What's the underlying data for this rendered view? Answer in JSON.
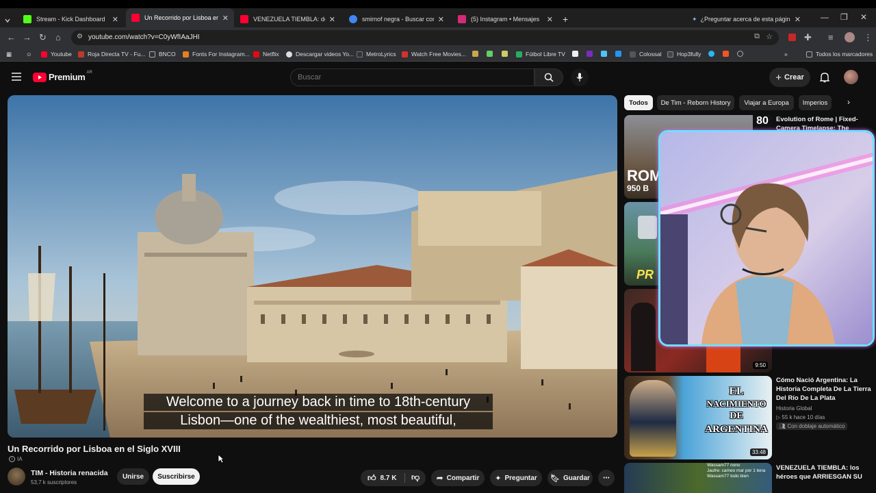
{
  "browser": {
    "tabs": [
      {
        "title": "Stream - Kick Dashboard",
        "color": "#53fc18",
        "active": false
      },
      {
        "title": "Un Recorrido por Lisboa en el S",
        "color": "#ff0033",
        "active": true
      },
      {
        "title": "VENEZUELA TIEMBLA: dentro d",
        "color": "#ff0033",
        "active": false
      },
      {
        "title": "smirnof negra - Buscar con Goo",
        "color": "#4285f4",
        "active": false
      },
      {
        "title": "(5) Instagram • Mensajes",
        "color": "#d62976",
        "active": false
      }
    ],
    "ask_page": "¿Preguntar acerca de esta página?",
    "url": "youtube.com/watch?v=C0yWfIAaJHI",
    "bookmarks": [
      {
        "label": "Youtube",
        "color": "#ff0033"
      },
      {
        "label": "Roja Directa TV - Fu...",
        "color": "#c0392b"
      },
      {
        "label": "BNCO",
        "color": "#888888"
      },
      {
        "label": "Fonts For Instagram...",
        "color": "#e67e22"
      },
      {
        "label": "Netflix",
        "color": "#e50914"
      },
      {
        "label": "Descargar videos Yo...",
        "color": "#dddddd"
      },
      {
        "label": "MetroLyrics",
        "color": "#333333"
      },
      {
        "label": "Watch Free Movies...",
        "color": "#d63031"
      },
      {
        "label": "Fútbol Libre TV",
        "color": "#27ae60"
      },
      {
        "label": "Colossal",
        "color": "#555555"
      },
      {
        "label": "Hop3fully",
        "color": "#444444"
      }
    ],
    "all_bookmarks": "Todos los marcadores"
  },
  "youtube": {
    "logo_text": "Premium",
    "logo_region": "AR",
    "search_placeholder": "Buscar",
    "create_label": "Crear",
    "video": {
      "caption_line1": "Welcome to a journey back in time to 18th-century",
      "caption_line2": "Lisbon—one of the wealthiest, most beautiful,",
      "title": "Un Recorrido por Lisboa en el Siglo XVIII",
      "ai_tag": "IA",
      "channel": "TIM - Historia renacida",
      "subscribers": "53,7 k suscriptores",
      "join_label": "Unirse",
      "subscribe_label": "Suscribirse",
      "likes": "8.7 K",
      "share_label": "Compartir",
      "ask_label": "Preguntar",
      "save_label": "Guardar"
    },
    "chips": [
      "Todos",
      "De Tim - Reborn History",
      "Viajar a Europa",
      "Imperios"
    ],
    "recommendations": [
      {
        "title": "Evolution of Rome | Fixed-Camera Timelapse: The",
        "thumb_text": "ROM",
        "thumb_sub": "950 B",
        "badge": "80"
      },
      {
        "title": "",
        "thumb_text": "PR"
      },
      {
        "title": "",
        "duration": "9:50"
      },
      {
        "title": "Cómo Nació Argentina: La Historia Completa De La Tierra Del Río De La Plata",
        "channel": "Historia Global",
        "meta": "55 k  hace 10 días",
        "dub": "Con doblaje automático",
        "duration": "33:48",
        "thumb_lines": [
          "EL",
          "NACIMIENTO",
          "DE",
          "ARGENTINA"
        ]
      },
      {
        "title": "VENEZUELA TIEMBLA: los héroes que ARRIESGAN SU"
      }
    ],
    "chat_overlay": [
      "Wassam77 nono",
      "Jaufre: cameo mar por 1 tena",
      "Wassam77 todo bien"
    ]
  }
}
